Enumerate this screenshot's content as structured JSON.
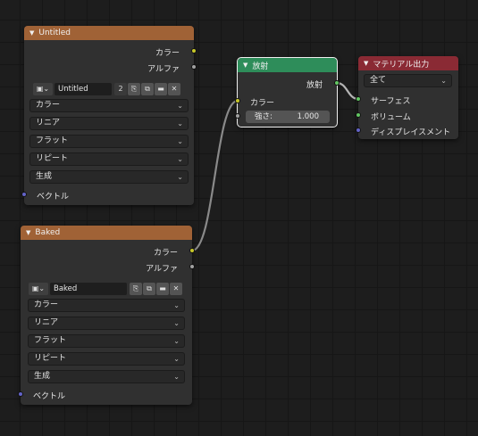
{
  "node_untitled": {
    "title": "Untitled",
    "out_color": "カラー",
    "out_alpha": "アルファ",
    "image_name": "Untitled",
    "users": "2",
    "interpolation": "カラー",
    "projection": "リニア",
    "extension_mode": "フラット",
    "repeat": "リピート",
    "source": "生成",
    "in_vector": "ベクトル"
  },
  "node_baked": {
    "title": "Baked",
    "out_color": "カラー",
    "out_alpha": "アルファ",
    "image_name": "Baked",
    "interpolation": "カラー",
    "projection": "リニア",
    "extension_mode": "フラット",
    "repeat": "リピート",
    "source": "生成",
    "in_vector": "ベクトル"
  },
  "node_emission": {
    "title": "放射",
    "out_emission": "放射",
    "in_color": "カラー",
    "strength_label": "強さ:",
    "strength_value": "1.000"
  },
  "node_output": {
    "title": "マテリアル出力",
    "target": "全て",
    "in_surface": "サーフェス",
    "in_volume": "ボリューム",
    "in_displacement": "ディスプレイスメント"
  },
  "icons": {
    "collapse": "triangle-down-icon",
    "image": "image-icon",
    "fake_user": "fake-user-icon",
    "duplicate": "duplicate-icon",
    "open": "folder-icon",
    "unlink": "close-icon",
    "dropdown": "chevron-down-icon"
  },
  "colors": {
    "texture_header": "#a06236",
    "shader_header": "#2e8d5a",
    "output_header": "#8a2a34",
    "socket_color": "#c7c729",
    "socket_float": "#a1a1a1",
    "socket_vector": "#6363c7",
    "socket_shader": "#63c763"
  }
}
